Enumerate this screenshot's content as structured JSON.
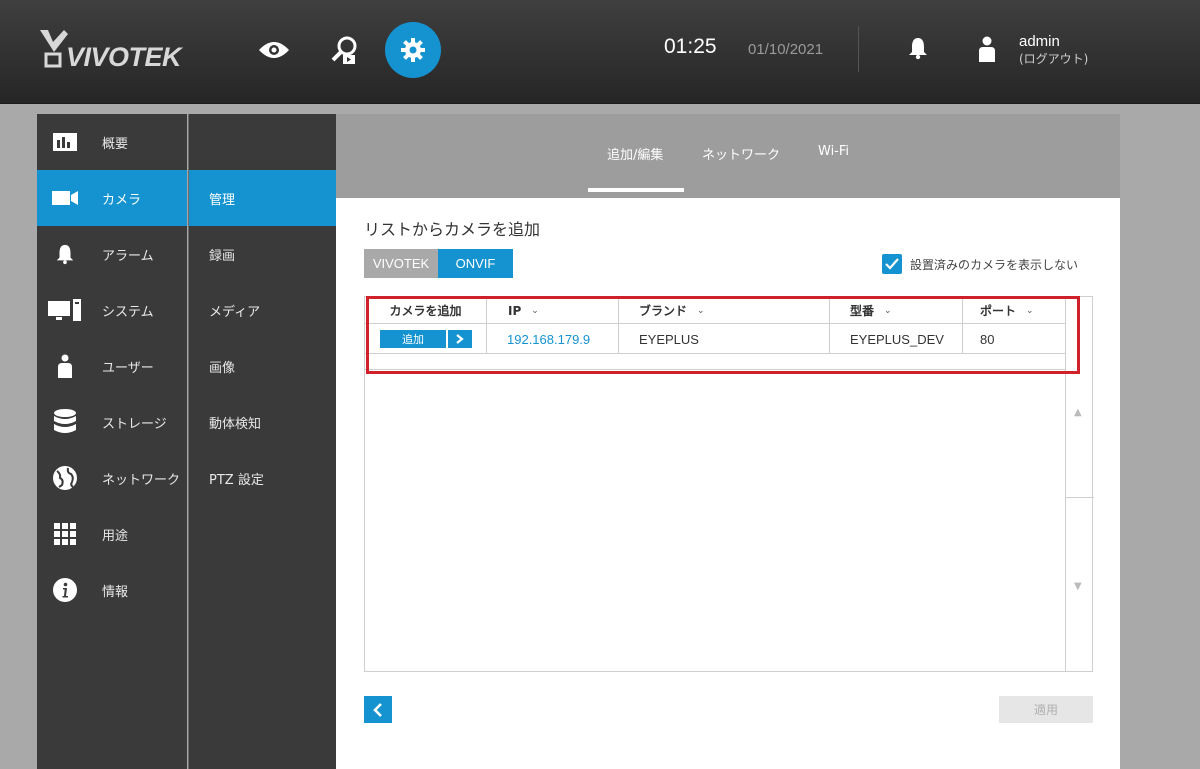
{
  "header": {
    "logo": "VIVOTEK",
    "time": "01:25",
    "date": "01/10/2021",
    "user": "admin",
    "logout": "(ログアウト)",
    "icons": [
      "eye-icon",
      "search-playback-icon",
      "gear-icon",
      "bell-icon",
      "user-icon"
    ],
    "accent": "#1593d1"
  },
  "sidebar": {
    "items": [
      {
        "label": "概要",
        "icon": "chart-icon"
      },
      {
        "label": "カメラ",
        "icon": "camera-icon",
        "active": true
      },
      {
        "label": "アラーム",
        "icon": "bell-icon"
      },
      {
        "label": "システム",
        "icon": "computer-icon"
      },
      {
        "label": "ユーザー",
        "icon": "user-icon"
      },
      {
        "label": "ストレージ",
        "icon": "database-icon"
      },
      {
        "label": "ネットワーク",
        "icon": "globe-icon"
      },
      {
        "label": "用途",
        "icon": "grid-icon"
      },
      {
        "label": "情報",
        "icon": "info-icon"
      }
    ]
  },
  "subnav": {
    "items": [
      {
        "label": "管理",
        "active": true
      },
      {
        "label": "録画"
      },
      {
        "label": "メディア"
      },
      {
        "label": "画像"
      },
      {
        "label": "動体検知"
      },
      {
        "label": "PTZ 設定"
      }
    ]
  },
  "tabs": [
    {
      "label": "追加/編集",
      "active": true
    },
    {
      "label": "ネットワーク"
    },
    {
      "label": "Wi-Fi"
    }
  ],
  "main": {
    "title": "リストからカメラを追加",
    "source_vivotek": "VIVOTEK",
    "source_onvif": "ONVIF",
    "hide_installed_label": "設置済みのカメラを表示しない",
    "hide_installed_checked": true,
    "apply_label": "適用"
  },
  "table": {
    "headers": [
      "カメラを追加",
      "IP",
      "ブランド",
      "型番",
      "ポート"
    ],
    "rows": [
      {
        "add_label": "追加",
        "ip": "192.168.179.9",
        "brand": "EYEPLUS",
        "model": "EYEPLUS_DEV",
        "port": "80"
      }
    ]
  }
}
